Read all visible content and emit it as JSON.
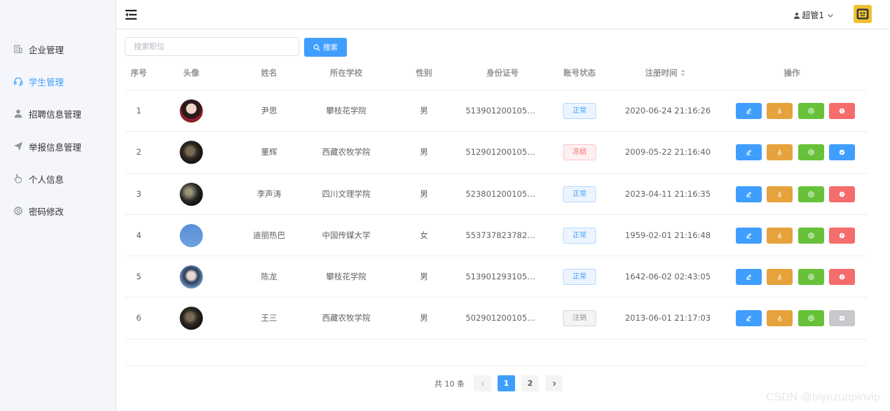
{
  "sidebar": {
    "items": [
      {
        "label": "企业管理",
        "icon": "building-icon"
      },
      {
        "label": "学生管理",
        "icon": "headset-icon"
      },
      {
        "label": "招聘信息管理",
        "icon": "user-icon"
      },
      {
        "label": "举报信息管理",
        "icon": "send-icon"
      },
      {
        "label": "个人信息",
        "icon": "hand-icon"
      },
      {
        "label": "密码修改",
        "icon": "gear-icon"
      }
    ]
  },
  "header": {
    "username": "超管1",
    "menu_icon": "fold-menu-icon"
  },
  "search": {
    "placeholder": "搜索职位",
    "button_label": "搜索"
  },
  "table": {
    "columns": [
      "序号",
      "头像",
      "姓名",
      "所在学校",
      "性别",
      "身份证号",
      "账号状态",
      "注册时间",
      "操作"
    ],
    "rows": [
      {
        "index": "1",
        "name": "尹思",
        "school": "攀枝花学院",
        "gender": "男",
        "id_number": "513901200105…",
        "status": "正常",
        "status_type": "ok",
        "registered": "2020-06-24 21:16:26",
        "last_action": "disable"
      },
      {
        "index": "2",
        "name": "董辉",
        "school": "西藏农牧学院",
        "gender": "男",
        "id_number": "512901200105…",
        "status": "冻结",
        "status_type": "frozen",
        "registered": "2009-05-22 21:16:40",
        "last_action": "enable"
      },
      {
        "index": "3",
        "name": "李声涛",
        "school": "四川文理学院",
        "gender": "男",
        "id_number": "523801200105…",
        "status": "正常",
        "status_type": "ok",
        "registered": "2023-04-11 21:16:35",
        "last_action": "disable"
      },
      {
        "index": "4",
        "name": "迪丽热巴",
        "school": "中国传媒大学",
        "gender": "女",
        "id_number": "553737823782…",
        "status": "正常",
        "status_type": "ok",
        "registered": "1959-02-01 21:16:48",
        "last_action": "disable"
      },
      {
        "index": "5",
        "name": "陈龙",
        "school": "攀枝花学院",
        "gender": "男",
        "id_number": "513901293105…",
        "status": "正常",
        "status_type": "ok",
        "registered": "1642-06-02 02:43:05",
        "last_action": "disable"
      },
      {
        "index": "6",
        "name": "王三",
        "school": "西藏农牧学院",
        "gender": "男",
        "id_number": "502901200105…",
        "status": "注销",
        "status_type": "off",
        "registered": "2013-06-01 21:17:03",
        "last_action": "none"
      }
    ]
  },
  "pagination": {
    "total_text": "共 10 条",
    "pages": [
      "1",
      "2"
    ],
    "current": "1"
  },
  "watermark": "CSDN @biyezuopinvip",
  "colors": {
    "primary": "#409eff",
    "warning": "#e6a23c",
    "success": "#67c23a",
    "danger": "#f56c6c",
    "disabled": "#c8c9cc"
  }
}
